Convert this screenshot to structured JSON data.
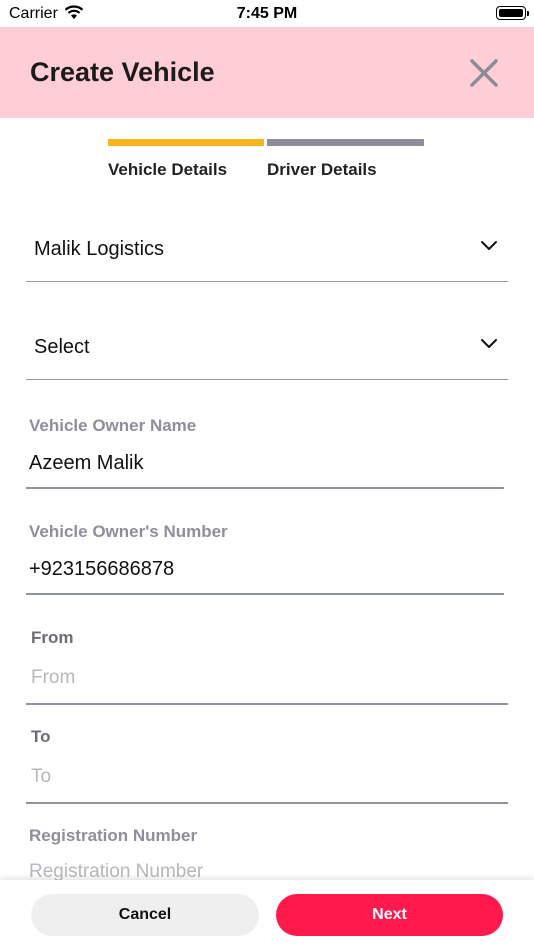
{
  "status_bar": {
    "carrier": "Carrier",
    "time": "7:45 PM"
  },
  "header": {
    "title": "Create Vehicle"
  },
  "stepper": {
    "steps": [
      {
        "label": "Vehicle Details",
        "active": true
      },
      {
        "label": "Driver Details",
        "active": false
      }
    ],
    "active_color": "#f6b51a",
    "inactive_color": "#8d8c99"
  },
  "form": {
    "company_dropdown": {
      "value": "Malik Logistics"
    },
    "type_dropdown": {
      "value": "Select"
    },
    "owner_name": {
      "label": "Vehicle Owner Name",
      "value": "Azeem Malik"
    },
    "owner_number": {
      "label": "Vehicle Owner's Number",
      "value": "+923156686878"
    },
    "from": {
      "label": "From",
      "placeholder": "From"
    },
    "to": {
      "label": "To",
      "placeholder": "To"
    },
    "registration": {
      "label": "Registration Number",
      "placeholder": "Registration Number"
    }
  },
  "actions": {
    "cancel_label": "Cancel",
    "next_label": "Next"
  },
  "colors": {
    "header_bg": "#ffcdd5",
    "primary": "#ff1a4b"
  }
}
